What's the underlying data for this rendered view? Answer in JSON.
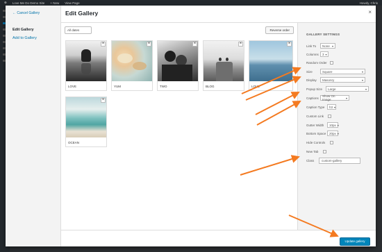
{
  "adminbar": {
    "site": "Love Me Do Demo Site",
    "new_label": "+ New",
    "view_page": "View Page",
    "howdy": "Howdy, Chris"
  },
  "menu": {
    "back": "← Cancel Gallery",
    "items": [
      "Edit Gallery",
      "Add to Gallery"
    ]
  },
  "modal": {
    "title": "Edit Gallery",
    "close": "×"
  },
  "toolbar": {
    "dates": "All dates",
    "reverse": "Reverse order"
  },
  "gallery": [
    {
      "caption": "LOVE"
    },
    {
      "caption": "YUM"
    },
    {
      "caption": "TWO"
    },
    {
      "caption": "BLOG"
    },
    {
      "caption": "LOVE"
    },
    {
      "caption": "OCEAN"
    }
  ],
  "settings": {
    "heading": "Gallery Settings",
    "link_to": {
      "label": "Link To",
      "value": "None"
    },
    "columns": {
      "label": "Columns",
      "value": "3"
    },
    "random_order": {
      "label": "Random Order"
    },
    "size": {
      "label": "Size",
      "value": "Square"
    },
    "display": {
      "label": "Display",
      "value": "Masonry"
    },
    "popup_size": {
      "label": "Popup Size",
      "value": "Large"
    },
    "captions": {
      "label": "Captions",
      "value": "Show On Image"
    },
    "caption_type": {
      "label": "Caption Type",
      "value": "h3"
    },
    "custom_link": {
      "label": "Custom Link"
    },
    "gutter_width": {
      "label": "Gutter Width",
      "value": "10px"
    },
    "bottom_space": {
      "label": "Bottom Space",
      "value": "20px"
    },
    "hide_controls": {
      "label": "Hide Controls"
    },
    "new_tab": {
      "label": "New Tab"
    },
    "class": {
      "label": "Class",
      "value": "custom-gallery"
    }
  },
  "footer": {
    "update": "Update gallery"
  },
  "colors": {
    "accent": "#0085ba",
    "arrow": "#f47a20"
  }
}
